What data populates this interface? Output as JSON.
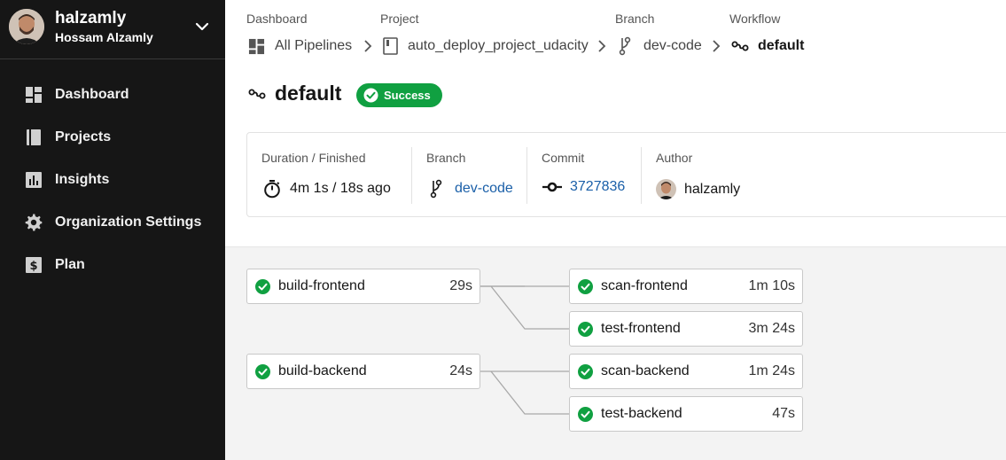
{
  "user": {
    "username": "halzamly",
    "full_name": "Hossam Alzamly"
  },
  "sidebar": {
    "items": [
      {
        "label": "Dashboard",
        "icon": "dashboard-icon"
      },
      {
        "label": "Projects",
        "icon": "projects-icon"
      },
      {
        "label": "Insights",
        "icon": "insights-icon"
      },
      {
        "label": "Organization Settings",
        "icon": "gear-icon"
      },
      {
        "label": "Plan",
        "icon": "plan-icon"
      }
    ]
  },
  "breadcrumb": {
    "labels": {
      "dashboard": "Dashboard",
      "project": "Project",
      "branch": "Branch",
      "workflow": "Workflow"
    },
    "values": {
      "dashboard": "All Pipelines",
      "project": "auto_deploy_project_udacity",
      "branch": "dev-code",
      "workflow": "default"
    }
  },
  "workflow": {
    "title": "default",
    "status": "Success",
    "status_color": "#10a041"
  },
  "details": {
    "duration_label": "Duration / Finished",
    "duration_value": "4m 1s / 18s ago",
    "branch_label": "Branch",
    "branch_value": "dev-code",
    "commit_label": "Commit",
    "commit_value": "3727836",
    "author_label": "Author",
    "author_value": "halzamly"
  },
  "jobs": [
    {
      "name": "build-frontend",
      "duration": "29s",
      "status": "success"
    },
    {
      "name": "scan-frontend",
      "duration": "1m 10s",
      "status": "success"
    },
    {
      "name": "test-frontend",
      "duration": "3m 24s",
      "status": "success"
    },
    {
      "name": "build-backend",
      "duration": "24s",
      "status": "success"
    },
    {
      "name": "scan-backend",
      "duration": "1m 24s",
      "status": "success"
    },
    {
      "name": "test-backend",
      "duration": "47s",
      "status": "success"
    }
  ]
}
